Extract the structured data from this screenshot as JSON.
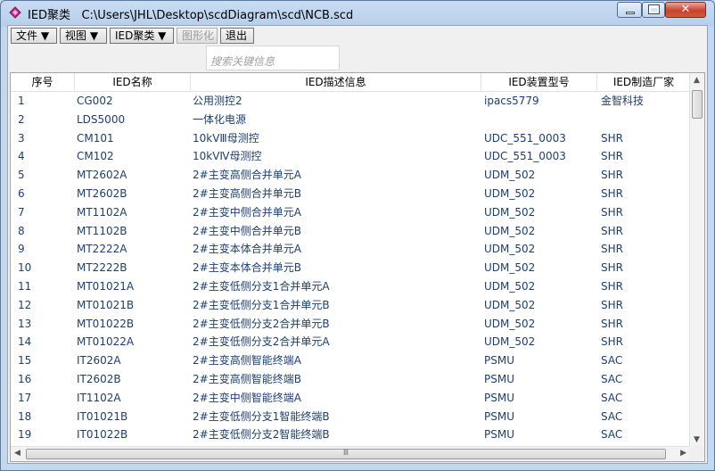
{
  "window": {
    "app_name": "IED聚类",
    "file_path": "C:\\Users\\JHL\\Desktop\\scdDiagram\\scd\\NCB.scd",
    "close_glyph": "✕"
  },
  "menu": {
    "file": "文件 ▼",
    "view": "视图 ▼",
    "cluster": "IED聚类 ▼",
    "graph": "图形化",
    "exit": "退出"
  },
  "search": {
    "placeholder": "搜索关键信息"
  },
  "table": {
    "columns": [
      "序号",
      "IED名称",
      "IED描述信息",
      "IED装置型号",
      "IED制造厂家"
    ],
    "rows": [
      [
        "1",
        "CG002",
        "公用测控2",
        "ipacs5779",
        "金智科技"
      ],
      [
        "2",
        "LDS5000",
        "一体化电源",
        "",
        ""
      ],
      [
        "3",
        "CM101",
        "10kVⅢ母测控",
        "UDC_551_0003",
        "SHR"
      ],
      [
        "4",
        "CM102",
        "10kVⅣ母测控",
        "UDC_551_0003",
        "SHR"
      ],
      [
        "5",
        "MT2602A",
        "2#主变高侧合并单元A",
        "UDM_502",
        "SHR"
      ],
      [
        "6",
        "MT2602B",
        "2#主变高侧合并单元B",
        "UDM_502",
        "SHR"
      ],
      [
        "7",
        "MT1102A",
        "2#主变中侧合并单元A",
        "UDM_502",
        "SHR"
      ],
      [
        "8",
        "MT1102B",
        "2#主变中侧合并单元B",
        "UDM_502",
        "SHR"
      ],
      [
        "9",
        "MT2222A",
        "2#主变本体合并单元A",
        "UDM_502",
        "SHR"
      ],
      [
        "10",
        "MT2222B",
        "2#主变本体合并单元B",
        "UDM_502",
        "SHR"
      ],
      [
        "11",
        "MT01021A",
        "2#主变低侧分支1合并单元A",
        "UDM_502",
        "SHR"
      ],
      [
        "12",
        "MT01021B",
        "2#主变低侧分支1合并单元B",
        "UDM_502",
        "SHR"
      ],
      [
        "13",
        "MT01022B",
        "2#主变低侧分支2合并单元B",
        "UDM_502",
        "SHR"
      ],
      [
        "14",
        "MT01022A",
        "2#主变低侧分支2合并单元A",
        "UDM_502",
        "SHR"
      ],
      [
        "15",
        "IT2602A",
        "2#主变高侧智能终端A",
        "PSMU",
        "SAC"
      ],
      [
        "16",
        "IT2602B",
        "2#主变高侧智能终端B",
        "PSMU",
        "SAC"
      ],
      [
        "17",
        "IT1102A",
        "2#主变中侧智能终端A",
        "PSMU",
        "SAC"
      ],
      [
        "18",
        "IT01021B",
        "2#主变低侧分支1智能终端B",
        "PSMU",
        "SAC"
      ],
      [
        "19",
        "IT01022B",
        "2#主变低侧分支2智能终端B",
        "PSMU",
        "SAC"
      ]
    ]
  },
  "scrollbar": {
    "hthumb_grip": "Ⅲ"
  }
}
